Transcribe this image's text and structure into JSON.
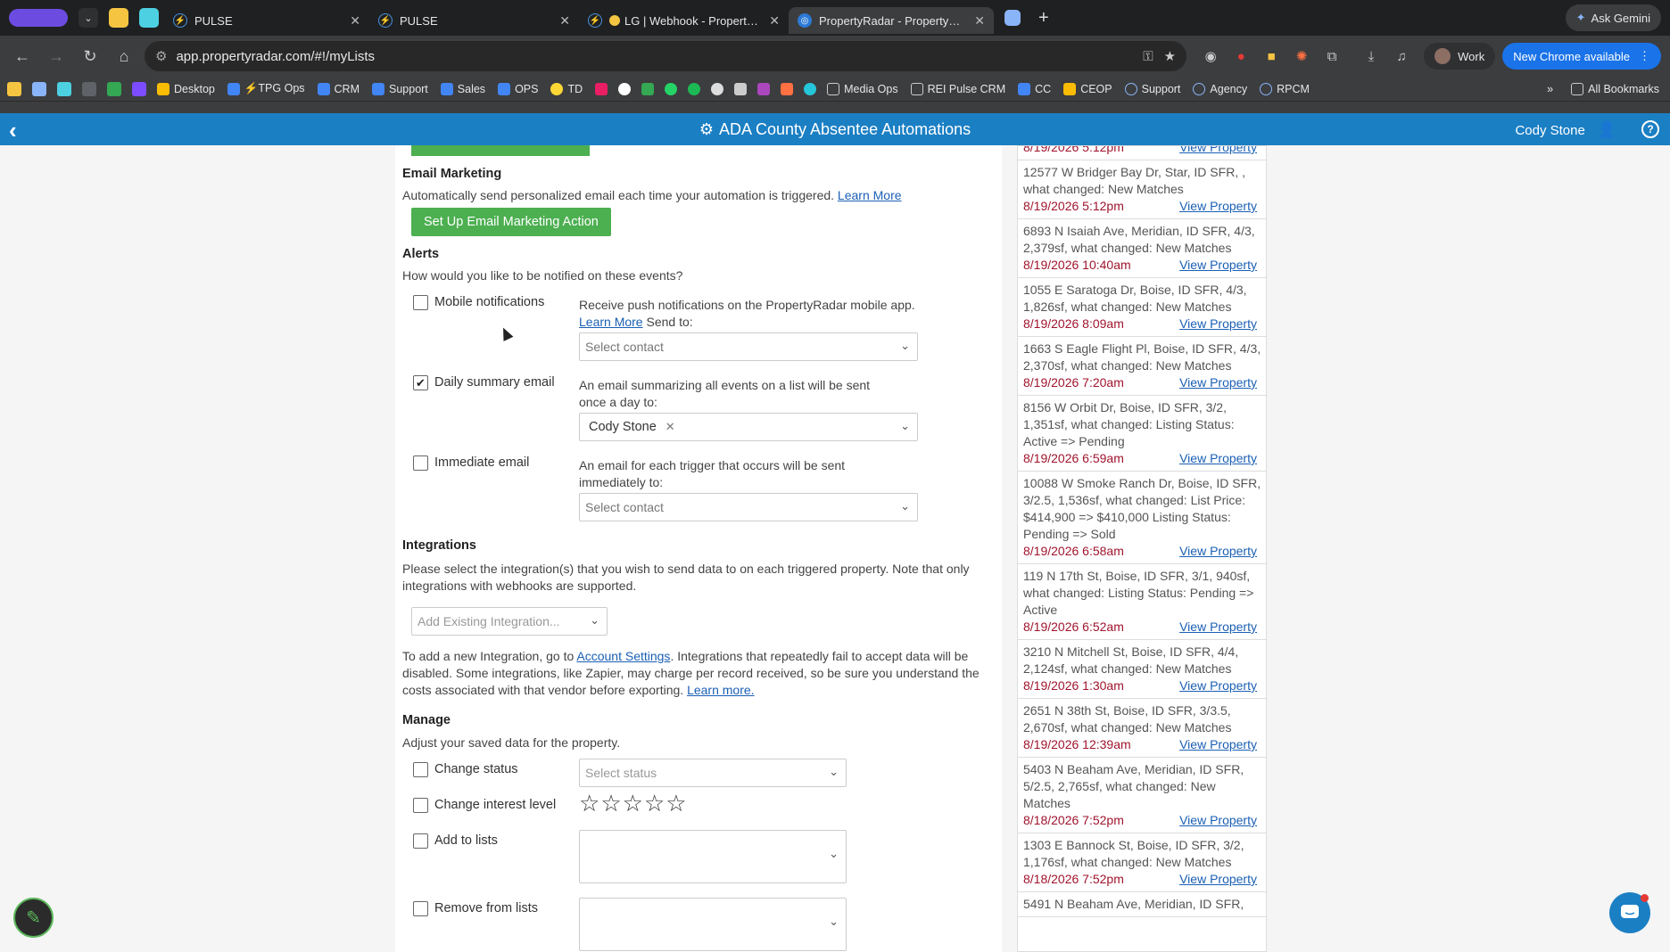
{
  "browser": {
    "tabs": [
      {
        "title": "PULSE",
        "active": false
      },
      {
        "title": "PULSE",
        "active": false
      },
      {
        "title": "LG | Webhook - Property R",
        "active": false
      },
      {
        "title": "PropertyRadar - PropertyRad",
        "active": true
      }
    ],
    "new_tab": "+",
    "ask_gemini": "Ask Gemini",
    "url": "app.propertyradar.com/#!/myLists",
    "profile": "Work",
    "update": "New Chrome available",
    "bookmarks": [
      "Desktop",
      "⚡TPG Ops",
      "CRM",
      "Support",
      "Sales",
      "OPS",
      "TD",
      "Media Ops",
      "REI Pulse CRM",
      "CC",
      "CEOP",
      "Support",
      "Agency",
      "RPCM"
    ],
    "all_bookmarks": "All Bookmarks",
    "more": "»"
  },
  "app": {
    "title": "ADA County Absentee Automations",
    "user": "Cody Stone"
  },
  "email_marketing": {
    "title": "Email Marketing",
    "desc": "Automatically send personalized email each time your automation is triggered.",
    "learn_more": "Learn More",
    "button": "Set Up Email Marketing Action"
  },
  "alerts": {
    "title": "Alerts",
    "desc": "How would you like to be notified on these events?",
    "mobile": {
      "label": "Mobile notifications",
      "checked": false,
      "desc_a": "Receive push notifications on the PropertyRadar mobile app.",
      "learn_more": "Learn More",
      "desc_b": "Send to:",
      "placeholder": "Select contact"
    },
    "daily": {
      "label": "Daily summary email",
      "checked": true,
      "desc": "An email summarizing all events on a list will be sent once a day to:",
      "selected": "Cody Stone"
    },
    "immediate": {
      "label": "Immediate email",
      "checked": false,
      "desc": "An email for each trigger that occurs will be sent immediately to:",
      "placeholder": "Select contact"
    }
  },
  "integrations": {
    "title": "Integrations",
    "desc": "Please select the integration(s) that you wish to send data to on each triggered property. Note that only integrations with webhooks are supported.",
    "placeholder": "Add Existing Integration...",
    "note_a": "To add a new Integration, go to",
    "account_settings": "Account Settings",
    "note_b": ". Integrations that repeatedly fail to accept data will be disabled. Some integrations, like Zapier, may charge per record received, so be sure you understand the costs associated with that vendor before exporting.",
    "learn_more": "Learn more."
  },
  "manage": {
    "title": "Manage",
    "desc": "Adjust your saved data for the property.",
    "change_status": "Change status",
    "status_placeholder": "Select status",
    "change_interest": "Change interest level",
    "interest_stars": 0,
    "interest_max": 5,
    "add_lists": "Add to lists",
    "remove_lists": "Remove from lists"
  },
  "events": {
    "top_partial_date": "8/19/2026 5:12pm",
    "link_text": "View Property",
    "items": [
      {
        "text": "12577 W Bridger Bay Dr, Star, ID SFR, , what changed: New Matches",
        "date": "8/19/2026 5:12pm"
      },
      {
        "text": "6893 N Isaiah Ave, Meridian, ID SFR, 4/3, 2,379sf, what changed: New Matches",
        "date": "8/19/2026 10:40am"
      },
      {
        "text": "1055 E Saratoga Dr, Boise, ID SFR, 4/3, 1,826sf, what changed: New Matches",
        "date": "8/19/2026 8:09am"
      },
      {
        "text": "1663 S Eagle Flight Pl, Boise, ID SFR, 4/3, 2,370sf, what changed: New Matches",
        "date": "8/19/2026 7:20am"
      },
      {
        "text": "8156 W Orbit Dr, Boise, ID SFR, 3/2, 1,351sf, what changed: Listing Status: Active => Pending",
        "date": "8/19/2026 6:59am"
      },
      {
        "text": "10088 W Smoke Ranch Dr, Boise, ID SFR, 3/2.5, 1,536sf, what changed: List Price: $414,900 => $410,000 Listing Status: Pending => Sold",
        "date": "8/19/2026 6:58am"
      },
      {
        "text": "119 N 17th St, Boise, ID SFR, 3/1, 940sf, what changed: Listing Status: Pending => Active",
        "date": "8/19/2026 6:52am"
      },
      {
        "text": "3210 N Mitchell St, Boise, ID SFR, 4/4, 2,124sf, what changed: New Matches",
        "date": "8/19/2026 1:30am"
      },
      {
        "text": "2651 N 38th St, Boise, ID SFR, 3/3.5, 2,670sf, what changed: New Matches",
        "date": "8/19/2026 12:39am"
      },
      {
        "text": "5403 N Beaham Ave, Meridian, ID SFR, 5/2.5, 2,765sf, what changed: New Matches",
        "date": "8/18/2026 7:52pm"
      },
      {
        "text": "1303 E Bannock St, Boise, ID SFR, 3/2, 1,176sf, what changed: New Matches",
        "date": "8/18/2026 7:52pm"
      },
      {
        "text": "5491 N Beaham Ave, Meridian, ID SFR,",
        "date": ""
      }
    ]
  }
}
